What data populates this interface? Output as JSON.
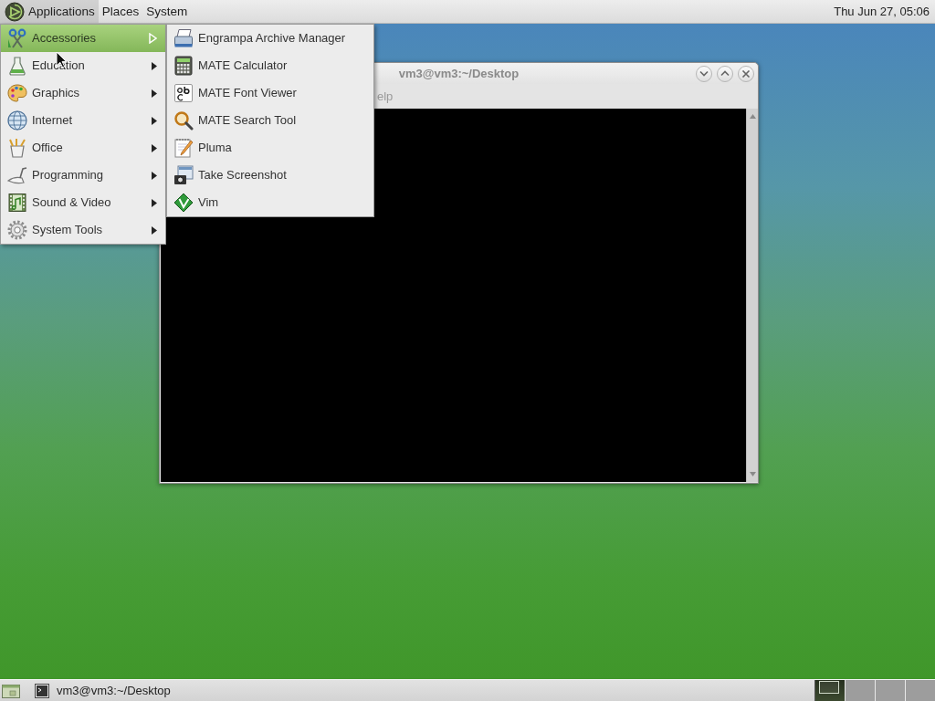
{
  "top_panel": {
    "menus": [
      {
        "label": "Applications",
        "selected": true
      },
      {
        "label": "Places",
        "selected": false
      },
      {
        "label": "System",
        "selected": false
      }
    ],
    "clock": "Thu Jun 27, 05:06"
  },
  "applications_menu": {
    "items": [
      {
        "label": "Accessories",
        "selected": true,
        "submenu": [
          {
            "label": "Engrampa Archive Manager"
          },
          {
            "label": "MATE Calculator"
          },
          {
            "label": "MATE Font Viewer"
          },
          {
            "label": "MATE Search Tool"
          },
          {
            "label": "Pluma"
          },
          {
            "label": "Take Screenshot"
          },
          {
            "label": "Vim"
          }
        ]
      },
      {
        "label": "Education",
        "selected": false
      },
      {
        "label": "Graphics",
        "selected": false
      },
      {
        "label": "Internet",
        "selected": false
      },
      {
        "label": "Office",
        "selected": false
      },
      {
        "label": "Programming",
        "selected": false
      },
      {
        "label": "Sound & Video",
        "selected": false
      },
      {
        "label": "System Tools",
        "selected": false
      }
    ]
  },
  "terminal_window": {
    "title": "vm3@vm3:~/Desktop",
    "focused": false,
    "menu_bar_fragment": "elp"
  },
  "bottom_panel": {
    "tasks": [
      {
        "label": "vm3@vm3:~/Desktop",
        "selected": false
      }
    ],
    "workspaces": [
      {
        "selected": true,
        "has_window": true
      },
      {
        "selected": false,
        "has_window": false
      },
      {
        "selected": false,
        "has_window": false
      },
      {
        "selected": false,
        "has_window": false
      }
    ]
  }
}
